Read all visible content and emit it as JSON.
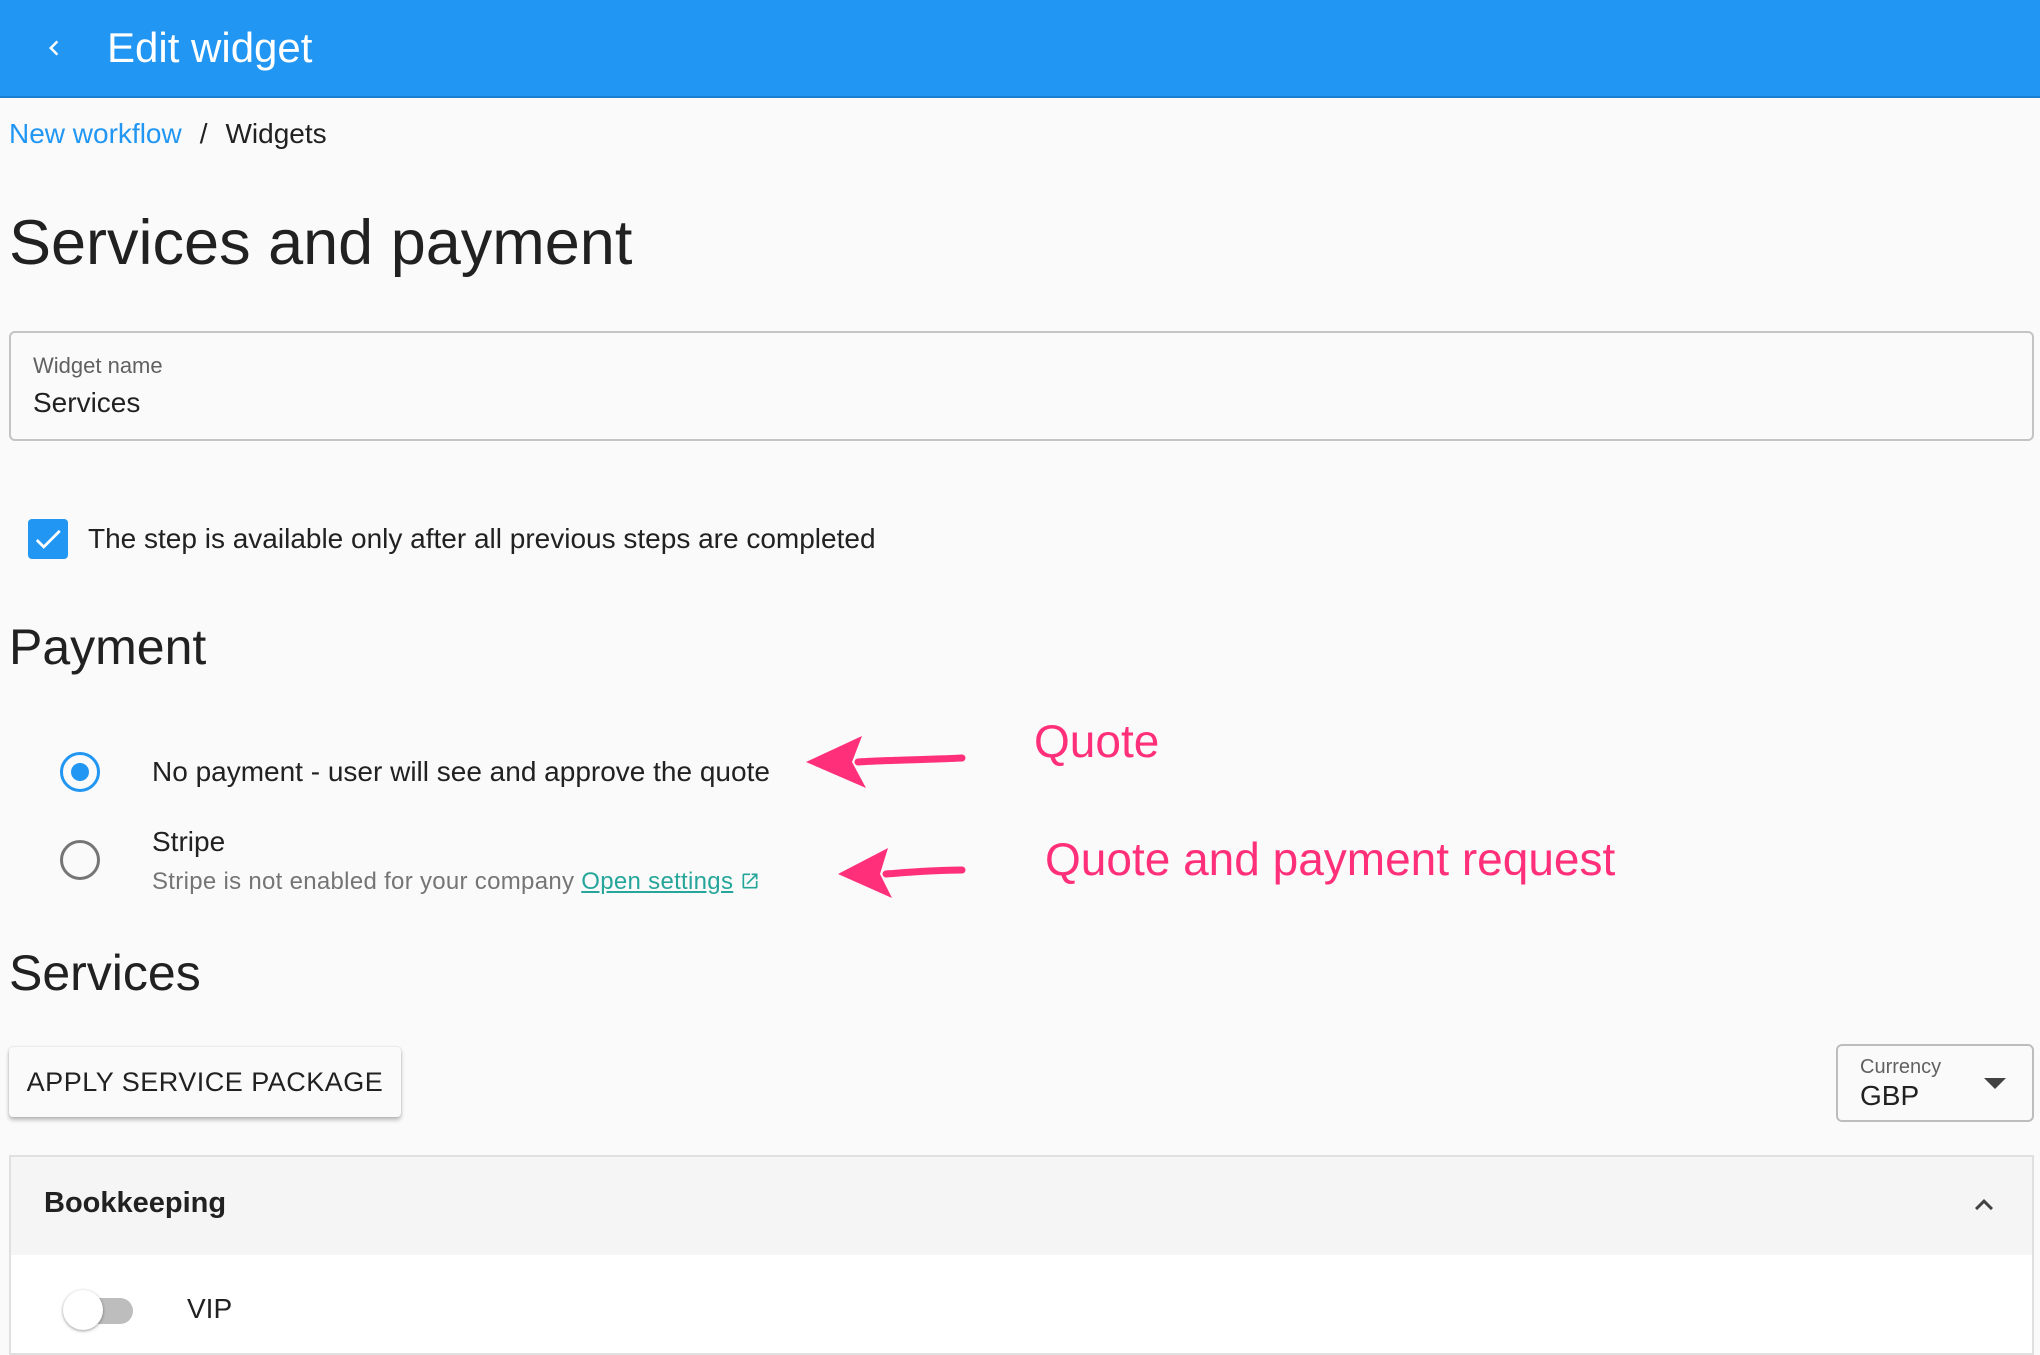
{
  "appbar": {
    "title": "Edit widget",
    "back_icon": "chevron-left-icon"
  },
  "breadcrumb": {
    "parent": "New workflow",
    "separator": "/",
    "current": "Widgets"
  },
  "page_title": "Services and payment",
  "widget_name_field": {
    "label": "Widget name",
    "value": "Services"
  },
  "step_checkbox": {
    "checked": true,
    "label": "The step is available only after all previous steps are completed"
  },
  "payment": {
    "heading": "Payment",
    "options": [
      {
        "label": "No payment - user will see and approve the quote",
        "selected": true
      },
      {
        "label": "Stripe",
        "selected": false,
        "sublabel": "Stripe is not enabled for your company",
        "link": "Open settings",
        "link_icon": "external-link-icon"
      }
    ]
  },
  "annotations": {
    "quote": "Quote",
    "quote_payment": "Quote and payment request",
    "color": "#ff2f7a"
  },
  "services": {
    "heading": "Services",
    "apply_button": "APPLY SERVICE PACKAGE",
    "currency": {
      "label": "Currency",
      "value": "GBP"
    },
    "panel": {
      "title": "Bookkeeping",
      "expanded": true,
      "items": [
        {
          "label": "VIP",
          "enabled": false
        }
      ]
    }
  },
  "colors": {
    "primary": "#2196f3",
    "link": "#26a69a",
    "annotation": "#ff2f7a"
  }
}
